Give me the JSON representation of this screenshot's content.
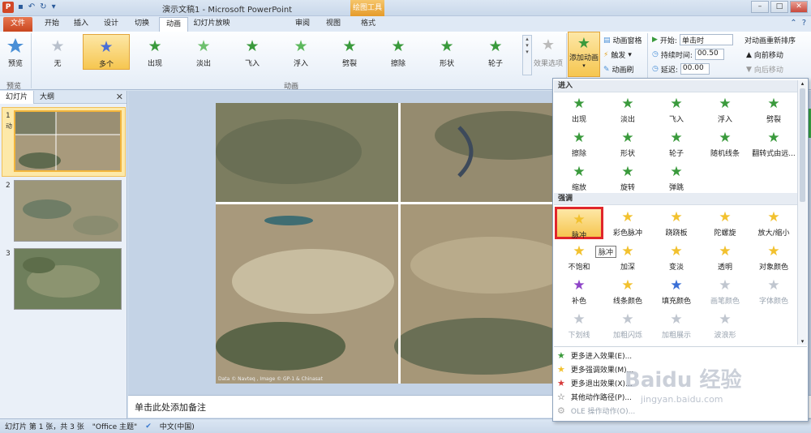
{
  "window": {
    "title": "演示文稿1 - Microsoft PowerPoint",
    "context_tab": "绘图工具",
    "app_icon": "P"
  },
  "tabs": [
    "文件",
    "开始",
    "插入",
    "设计",
    "切换",
    "动画",
    "幻灯片放映",
    "审阅",
    "视图",
    "格式"
  ],
  "active_tab": "动画",
  "ribbon": {
    "preview_label": "预览",
    "preview_group": "预览",
    "animation_group": "动画",
    "animations": [
      "无",
      "多个",
      "出现",
      "淡出",
      "飞入",
      "浮入",
      "劈裂",
      "擦除",
      "形状",
      "轮子"
    ],
    "selected_animation": "多个",
    "effect_options": "效果选项",
    "add_animation": "添加动画",
    "animation_pane": "动画窗格",
    "trigger": "触发",
    "animation_painter": "动画刷",
    "start_label": "开始:",
    "start_value": "单击时",
    "duration_label": "持续时间:",
    "duration_value": "00.50",
    "delay_label": "延迟:",
    "delay_value": "00.00",
    "reorder_label": "对动画重新排序",
    "move_earlier": "向前移动",
    "move_later": "向后移动"
  },
  "left_panel": {
    "tab_slides": "幻灯片",
    "tab_outline": "大纲",
    "slides": [
      {
        "num": "1"
      },
      {
        "num": "2"
      },
      {
        "num": "3"
      }
    ],
    "slide1_marker": "动"
  },
  "notes_placeholder": "单击此处添加备注",
  "slide_credit": "Data © Navteq , Image © GP-1 & Chinasat",
  "status": {
    "slide_info": "幻灯片 第 1 张，共 3 张",
    "theme": "\"Office 主题\"",
    "language": "中文(中国)"
  },
  "gallery": {
    "entrance_header": "进入",
    "entrance": [
      "出现",
      "淡出",
      "飞入",
      "浮入",
      "劈裂",
      "擦除",
      "形状",
      "轮子",
      "随机线条",
      "翻转式由远...",
      "缩放",
      "旋转",
      "弹跳"
    ],
    "emphasis_header": "强调",
    "emphasis": [
      "脉冲",
      "彩色脉冲",
      "跷跷板",
      "陀螺旋",
      "放大/缩小",
      "不饱和",
      "加深",
      "变淡",
      "透明",
      "对象颜色",
      "补色",
      "线条颜色",
      "填充颜色",
      "画笔颜色",
      "字体颜色",
      "下划线",
      "加粗闪烁",
      "加粗展示",
      "波浪形"
    ],
    "highlighted": "脉冲",
    "tooltip": "脉冲",
    "more": [
      "更多进入效果(E)...",
      "更多强调效果(M)...",
      "更多退出效果(X)...",
      "其他动作路径(P)...",
      "OLE 操作动作(O)..."
    ]
  },
  "watermark": {
    "text": "Baidu 经验",
    "sub": "jingyan.baidu.com"
  },
  "colors": {
    "accent": "#f6c650",
    "highlight_border": "#e0262b",
    "entrance": "#3a9a3c",
    "emphasis": "#f2c12e"
  }
}
